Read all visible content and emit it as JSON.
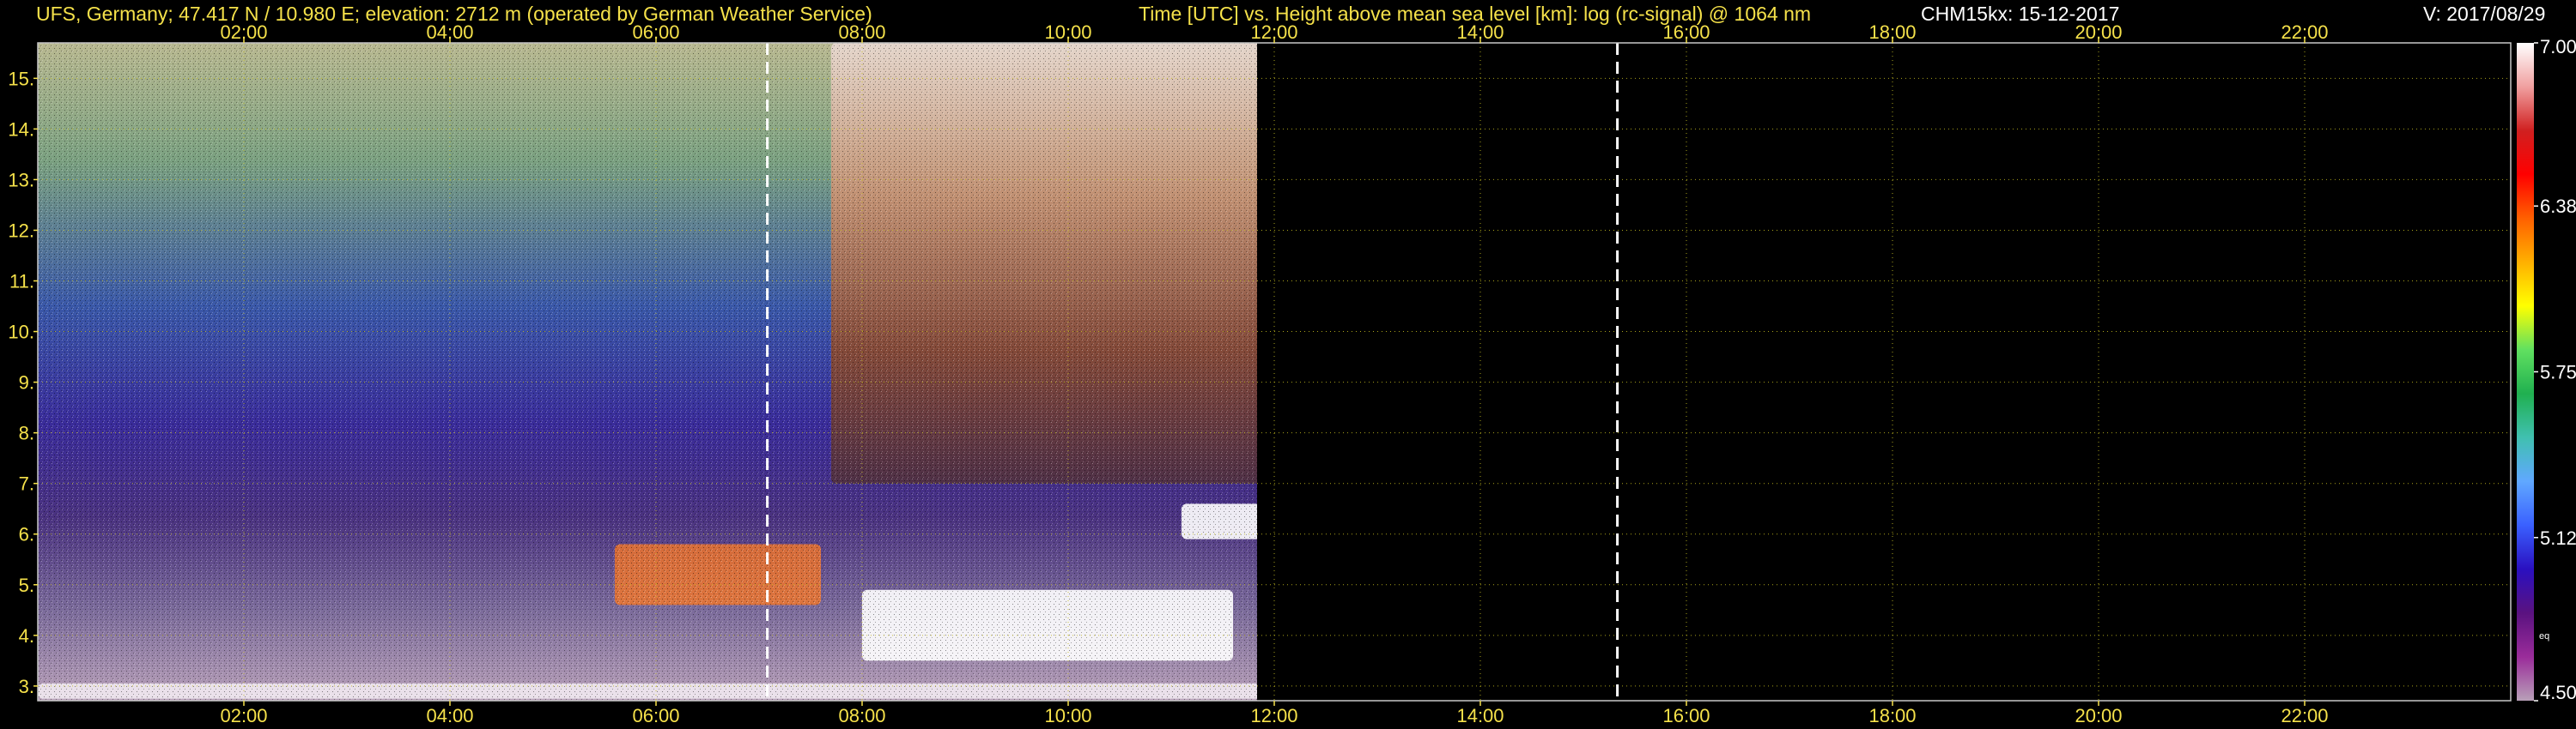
{
  "header": {
    "station": "UFS, Germany; 47.417 N / 10.980 E; elevation: 2712 m  (operated by German Weather Service)",
    "title": "Time [UTC] vs. Height above mean sea level [km]: log (rc-signal) @ 1064 nm",
    "instrument_date": "CHM15kx: 15-12-2017",
    "version": "V: 2017/08/29"
  },
  "colorbar": {
    "ticks": [
      "7.00",
      "6.38",
      "5.75",
      "5.12",
      "4.50"
    ],
    "small_label": "eq"
  },
  "chart_data": {
    "type": "heatmap",
    "title": "Time [UTC] vs. Height above mean sea level [km]: log (rc-signal) @ 1064 nm",
    "xlabel": "Time [UTC]",
    "ylabel": "Height above mean sea level [km]",
    "x_range": [
      0.0,
      24.0
    ],
    "y_range": [
      2.71,
      15.7
    ],
    "x_tick_values": [
      2,
      4,
      6,
      8,
      10,
      12,
      14,
      16,
      18,
      20,
      22
    ],
    "x_tick_labels": [
      "02:00",
      "04:00",
      "06:00",
      "08:00",
      "10:00",
      "12:00",
      "14:00",
      "16:00",
      "18:00",
      "20:00",
      "22:00"
    ],
    "y_tick_values": [
      3,
      4,
      5,
      6,
      7,
      8,
      9,
      10,
      11,
      12,
      13,
      14,
      15
    ],
    "y_tick_labels": [
      "3.",
      "4.",
      "5.",
      "6.",
      "7.",
      "8.",
      "9.",
      "10.",
      "11.",
      "12.",
      "13.",
      "14.",
      "15."
    ],
    "value_range": [
      4.5,
      7.0
    ],
    "value_ticks": [
      7.0,
      6.38,
      5.75,
      5.12,
      4.5
    ],
    "colorscale": [
      "#b8a0b8",
      "#9a2c9a",
      "#5a1280",
      "#2a10c0",
      "#3a60ff",
      "#60a8ff",
      "#40c0b0",
      "#20b050",
      "#60e060",
      "#ffff00",
      "#ffb000",
      "#ff6000",
      "#ff0000",
      "#d02020",
      "#f0a0a0",
      "#ffffff"
    ],
    "dashed_vertical_lines_x": [
      7.08,
      15.33
    ],
    "grid": true,
    "features": [
      {
        "name": "low-level layer",
        "x": [
          0.0,
          24.0
        ],
        "y": [
          2.75,
          3.05
        ]
      },
      {
        "name": "aerosol plume",
        "x": [
          5.6,
          7.6
        ],
        "y": [
          4.6,
          5.8
        ]
      },
      {
        "name": "cloud layer",
        "x": [
          8.0,
          11.6
        ],
        "y": [
          3.5,
          4.9
        ]
      },
      {
        "name": "cloud layer",
        "x": [
          11.1,
          13.15
        ],
        "y": [
          5.9,
          6.6
        ]
      },
      {
        "name": "high signal region",
        "x": [
          7.7,
          13.1
        ],
        "y": [
          7.0,
          15.7
        ]
      }
    ]
  }
}
